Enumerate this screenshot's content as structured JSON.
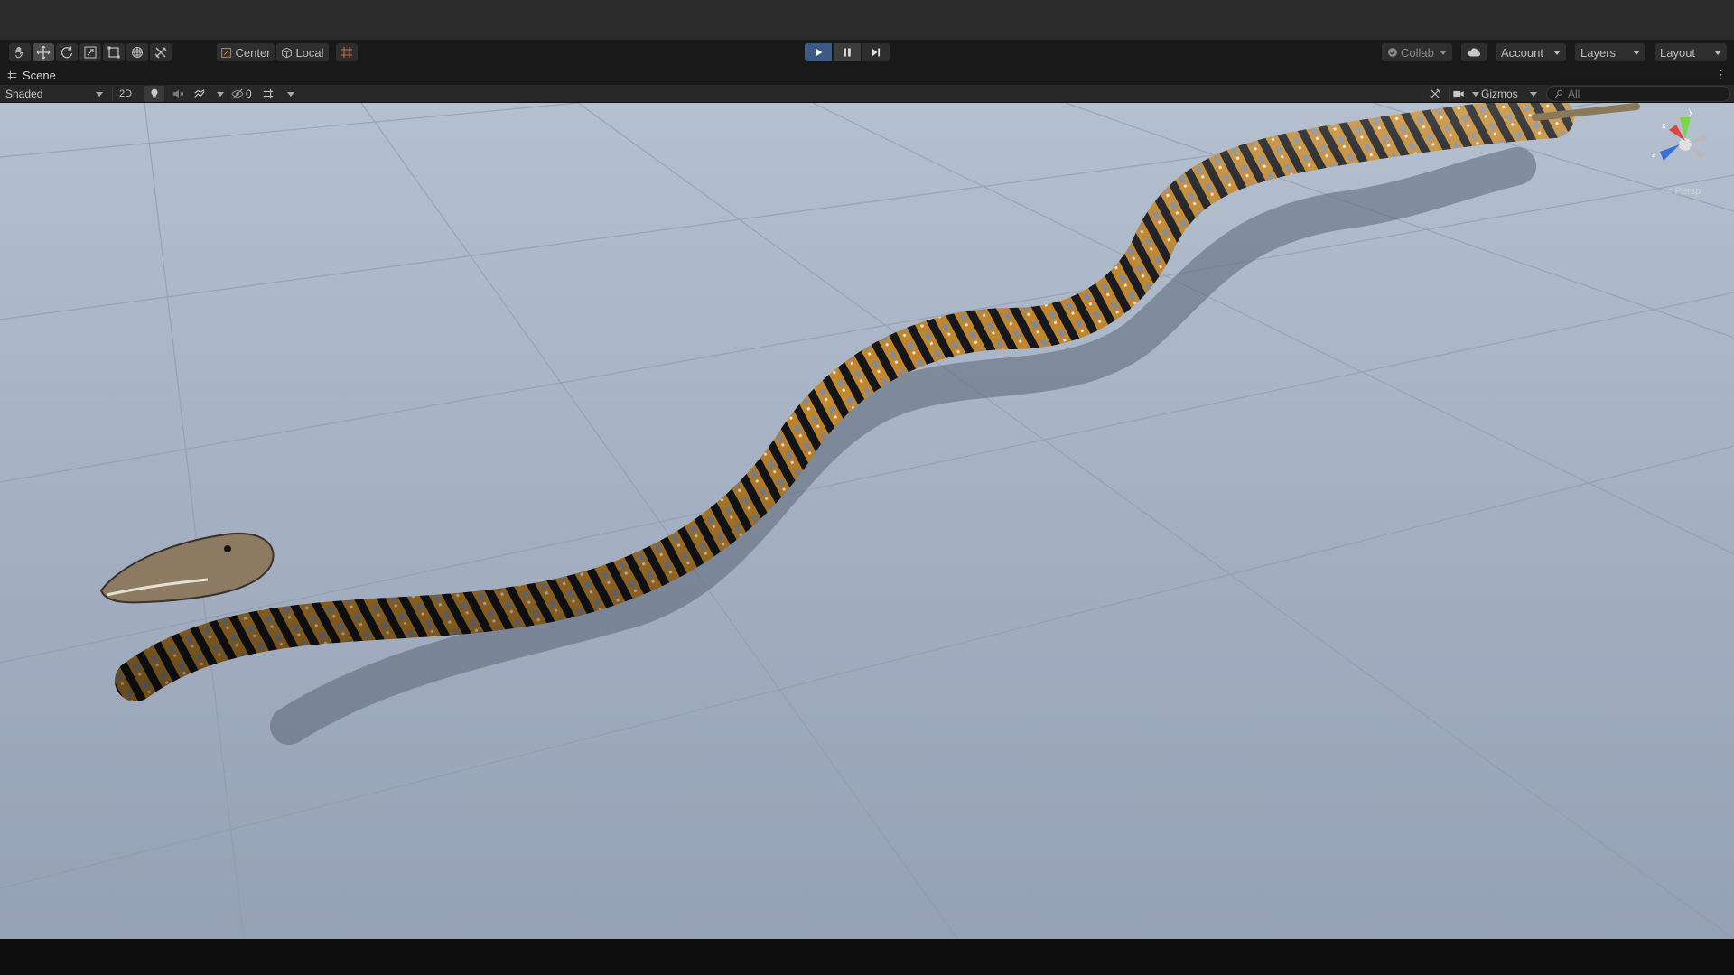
{
  "toolbar": {
    "tools": [
      {
        "name": "hand-tool",
        "icon": "hand-icon"
      },
      {
        "name": "move-tool",
        "icon": "move-icon",
        "active": true
      },
      {
        "name": "rotate-tool",
        "icon": "rotate-icon"
      },
      {
        "name": "scale-tool",
        "icon": "scale-icon"
      },
      {
        "name": "rect-tool",
        "icon": "rect-icon"
      },
      {
        "name": "transform-tool",
        "icon": "transform-icon"
      },
      {
        "name": "custom-tool",
        "icon": "tools-icon"
      }
    ],
    "pivot_label": "Center",
    "space_label": "Local",
    "play": {
      "play_icon": "play-icon",
      "pause_icon": "pause-icon",
      "step_icon": "step-icon"
    },
    "collab_label": "Collab",
    "cloud_icon": "cloud-icon",
    "account_label": "Account",
    "layers_label": "Layers",
    "layout_label": "Layout"
  },
  "tab": {
    "label": "Scene",
    "icon": "grid-icon",
    "menu_icon": "⋮"
  },
  "scene_bar": {
    "draw_mode": "Shaded",
    "mode_2d": "2D",
    "hidden_count": "0",
    "gizmos_label": "Gizmos",
    "search_placeholder": "All"
  },
  "viewport": {
    "gizmo_axes": {
      "y": "y",
      "x": "x",
      "z": "z"
    },
    "projection_label": "< Persp"
  },
  "colors": {
    "accent_play": "#3a5a82",
    "toolbar_bg": "#191919",
    "scene_sky": "#a9b5c6",
    "snake_gold": "#c6892c",
    "snake_gray": "#8a8c93"
  }
}
